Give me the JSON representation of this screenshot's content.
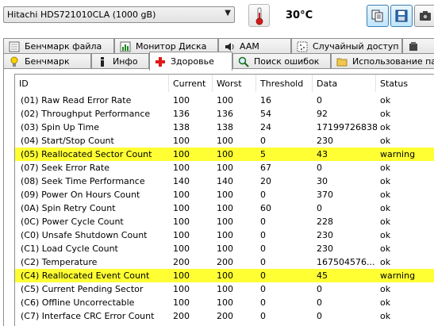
{
  "toolbar": {
    "drive": "Hitachi HDS721010CLA (1000 gB)",
    "temperature": "30°C",
    "thermometer_icon": "thermometer-icon",
    "buttons": [
      "copy-icon",
      "save-icon",
      "camera-icon"
    ]
  },
  "tabs": {
    "row1": [
      {
        "label": "Бенчмарк файла",
        "icon": "file-benchmark-icon"
      },
      {
        "label": "Монитор Диска",
        "icon": "disk-monitor-icon"
      },
      {
        "label": "AAM",
        "icon": "speaker-icon"
      },
      {
        "label": "Случайный доступ",
        "icon": "random-access-icon"
      },
      {
        "label": "",
        "icon": "extra-icon"
      }
    ],
    "row2": [
      {
        "label": "Бенчмарк",
        "icon": "lightbulb-icon"
      },
      {
        "label": "Инфо",
        "icon": "info-icon"
      },
      {
        "label": "Здоровье",
        "icon": "health-cross-icon",
        "active": true
      },
      {
        "label": "Поиск ошибок",
        "icon": "magnifier-icon"
      },
      {
        "label": "Использование па",
        "icon": "folder-icon"
      }
    ]
  },
  "table": {
    "columns": [
      "ID",
      "Current",
      "Worst",
      "Threshold",
      "Data",
      "Status"
    ],
    "rows": [
      {
        "id": "(01) Raw Read Error Rate",
        "current": "100",
        "worst": "100",
        "threshold": "16",
        "data": "0",
        "status": "ok",
        "warn": false
      },
      {
        "id": "(02) Throughput Performance",
        "current": "136",
        "worst": "136",
        "threshold": "54",
        "data": "92",
        "status": "ok",
        "warn": false
      },
      {
        "id": "(03) Spin Up Time",
        "current": "138",
        "worst": "138",
        "threshold": "24",
        "data": "17199726838",
        "status": "ok",
        "warn": false
      },
      {
        "id": "(04) Start/Stop Count",
        "current": "100",
        "worst": "100",
        "threshold": "0",
        "data": "230",
        "status": "ok",
        "warn": false
      },
      {
        "id": "(05) Reallocated Sector Count",
        "current": "100",
        "worst": "100",
        "threshold": "5",
        "data": "43",
        "status": "warning",
        "warn": true
      },
      {
        "id": "(07) Seek Error Rate",
        "current": "100",
        "worst": "100",
        "threshold": "67",
        "data": "0",
        "status": "ok",
        "warn": false
      },
      {
        "id": "(08) Seek Time Performance",
        "current": "140",
        "worst": "140",
        "threshold": "20",
        "data": "30",
        "status": "ok",
        "warn": false
      },
      {
        "id": "(09) Power On Hours Count",
        "current": "100",
        "worst": "100",
        "threshold": "0",
        "data": "370",
        "status": "ok",
        "warn": false
      },
      {
        "id": "(0A) Spin Retry Count",
        "current": "100",
        "worst": "100",
        "threshold": "60",
        "data": "0",
        "status": "ok",
        "warn": false
      },
      {
        "id": "(0C) Power Cycle Count",
        "current": "100",
        "worst": "100",
        "threshold": "0",
        "data": "228",
        "status": "ok",
        "warn": false
      },
      {
        "id": "(C0) Unsafe Shutdown Count",
        "current": "100",
        "worst": "100",
        "threshold": "0",
        "data": "230",
        "status": "ok",
        "warn": false
      },
      {
        "id": "(C1) Load Cycle Count",
        "current": "100",
        "worst": "100",
        "threshold": "0",
        "data": "230",
        "status": "ok",
        "warn": false
      },
      {
        "id": "(C2) Temperature",
        "current": "200",
        "worst": "200",
        "threshold": "0",
        "data": "167504576...",
        "status": "ok",
        "warn": false
      },
      {
        "id": "(C4) Reallocated Event Count",
        "current": "100",
        "worst": "100",
        "threshold": "0",
        "data": "45",
        "status": "warning",
        "warn": true
      },
      {
        "id": "(C5) Current Pending Sector",
        "current": "100",
        "worst": "100",
        "threshold": "0",
        "data": "0",
        "status": "ok",
        "warn": false
      },
      {
        "id": "(C6) Offline Uncorrectable",
        "current": "100",
        "worst": "100",
        "threshold": "0",
        "data": "0",
        "status": "ok",
        "warn": false
      },
      {
        "id": "(C7) Interface CRC Error Count",
        "current": "200",
        "worst": "200",
        "threshold": "0",
        "data": "0",
        "status": "ok",
        "warn": false
      }
    ]
  },
  "colors": {
    "warning_row": "#ffff33",
    "active_tab": "#ffffff"
  }
}
